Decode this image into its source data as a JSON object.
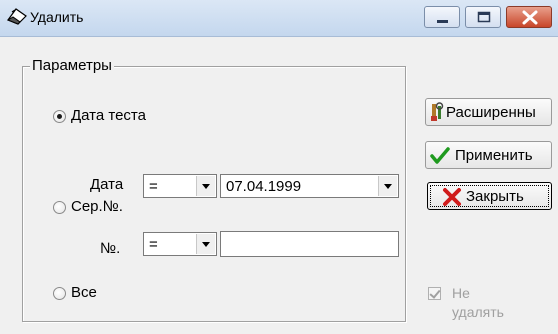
{
  "window": {
    "title": "Удалить",
    "icons": {
      "app": "eraser-icon",
      "minimize": "minimize-icon",
      "maximize": "maximize-icon",
      "close": "close-icon"
    }
  },
  "parameters": {
    "group_label": "Параметры",
    "options": [
      {
        "label": "Дата теста",
        "selected": true
      },
      {
        "label": "Сер.№.",
        "selected": false
      },
      {
        "label": "Все",
        "selected": false
      }
    ],
    "date_row": {
      "label": "Дата",
      "operator": "=",
      "value": "07.04.1999"
    },
    "serial_row": {
      "label": "№.",
      "operator": "=",
      "value": ""
    }
  },
  "buttons": {
    "advanced": {
      "label": "Расширенны",
      "icon": "tools-icon"
    },
    "apply": {
      "label": "Применить",
      "icon": "checkmark-icon"
    },
    "close": {
      "label": "Закрыть",
      "icon": "red-x-icon"
    }
  },
  "no_delete": {
    "label_line1": "Не",
    "label_line2": "удалять",
    "checked": true,
    "disabled": true
  },
  "colors": {
    "titlebar": "#c4d7ee",
    "close_button": "#c8462a",
    "disabled_text": "#a0a0a0"
  }
}
